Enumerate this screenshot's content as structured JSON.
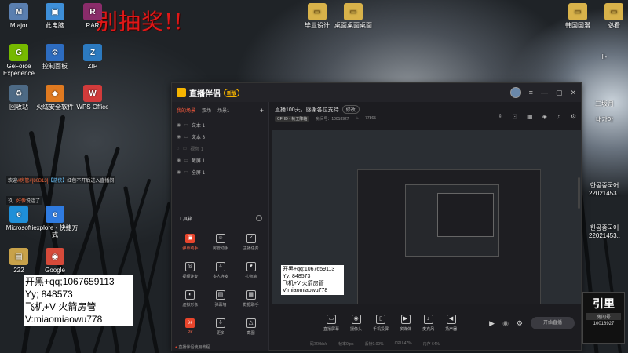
{
  "desktop": {
    "icons": [
      {
        "id": "major",
        "label": "M ajor",
        "glyph": "M",
        "color": "#5a7fb0"
      },
      {
        "id": "computer",
        "label": "此电脑",
        "glyph": "▣",
        "color": "#3e8fd8"
      },
      {
        "id": "rar",
        "label": "RAR",
        "glyph": "R",
        "color": "#8a2c6a"
      },
      {
        "id": "geforce",
        "label": "GeForce Experience",
        "glyph": "G",
        "color": "#76b900"
      },
      {
        "id": "control",
        "label": "控制面板",
        "glyph": "⚙",
        "color": "#2d6cc0"
      },
      {
        "id": "zip",
        "label": "ZIP",
        "glyph": "Z",
        "color": "#2c7ac0"
      },
      {
        "id": "recycle",
        "label": "回收站",
        "glyph": "♻",
        "color": "#4d6a85"
      },
      {
        "id": "security",
        "label": "火绒安全软件",
        "glyph": "◆",
        "color": "#e07a20"
      },
      {
        "id": "wps",
        "label": "WPS Office",
        "glyph": "W",
        "color": "#d13b3b"
      },
      {
        "id": "edge",
        "label": "Microsoft",
        "glyph": "e",
        "color": "#1f8fd8"
      },
      {
        "id": "iexplore",
        "label": "iexplore - 快捷方式",
        "glyph": "e",
        "color": "#2f7be0"
      },
      {
        "id": "num222",
        "label": "222",
        "glyph": "▤",
        "color": "#c8a24a"
      },
      {
        "id": "google",
        "label": "Google",
        "glyph": "◉",
        "color": "#d64a3a"
      },
      {
        "id": "folder1",
        "label": "毕业设计",
        "glyph": "▭",
        "color": "#d8b24a"
      },
      {
        "id": "folder2",
        "label": "桌面桌面桌面",
        "glyph": "▭",
        "color": "#d8b24a"
      },
      {
        "id": "folder3",
        "label": "韩国国漫",
        "glyph": "▭",
        "color": "#d8b24a"
      },
      {
        "id": "folder4",
        "label": "必看",
        "glyph": "▭",
        "color": "#d8b24a"
      }
    ],
    "right_labels": [
      "ll-",
      "三坂月",
      "내가아",
      "한공중국어",
      "22021453..",
      "한공중국어",
      "22021453.."
    ],
    "banner": "别抽奖!!"
  },
  "chat": {
    "line1_prefix": "欢迎",
    "line1_user": "#房管#[80B13]",
    "line1_tag": "【游侠】",
    "line1_text": "红包不开后进入直播间",
    "line2_prefix": "玖...",
    "line2_user": "好像",
    "line2_text": "说话了"
  },
  "contact": {
    "line1": "开黑+qq;1067659113",
    "line2": "Yy; 848573",
    "line3": "飞机+V 火箭房管",
    "line4": "V:miaomiaowu778"
  },
  "app": {
    "title": "直播伴侣",
    "version": "新版",
    "scene_tabs": [
      "我的场景",
      "双场",
      "场景1"
    ],
    "sources": [
      {
        "label": "文本 1",
        "dim": false
      },
      {
        "label": "文本 3",
        "dim": false
      },
      {
        "label": "视频 1",
        "dim": true
      },
      {
        "label": "截屏 1",
        "dim": false
      },
      {
        "label": "全屏 1",
        "dim": false
      }
    ],
    "tools_label": "工具箱",
    "tools": [
      {
        "label": "弹幕助手",
        "icon": "▣",
        "active": true
      },
      {
        "label": "房管助手",
        "icon": "☺",
        "active": false
      },
      {
        "label": "主播任务",
        "icon": "✓",
        "active": false
      },
      {
        "label": "视频连麦",
        "icon": "◎",
        "active": false
      },
      {
        "label": "多人连麦",
        "icon": "⇩",
        "active": false
      },
      {
        "label": "礼物墙",
        "icon": "♥",
        "active": false
      },
      {
        "label": "虚拟形象",
        "icon": "◐",
        "active": false
      },
      {
        "label": "弹幕墙",
        "icon": "▤",
        "active": false
      },
      {
        "label": "数据助手",
        "icon": "▦",
        "active": false
      },
      {
        "label": "PK",
        "icon": "⚔",
        "active": false
      },
      {
        "label": "更多",
        "icon": "⇩",
        "active": false
      },
      {
        "label": "截图",
        "icon": "△",
        "active": false
      }
    ],
    "notice": "直播伴侣使用教程",
    "room_title": "直播100天，感谢各位支持",
    "room_edit": "修改",
    "room_tag": "CFHD - 枪王降临",
    "room_id_label": "房间号：10018927",
    "room_heat": "77865",
    "bottom_tools": [
      {
        "label": "直播屏幕",
        "icon": "▭"
      },
      {
        "label": "摄像头",
        "icon": "◉"
      },
      {
        "label": "手机投屏",
        "icon": "▯"
      },
      {
        "label": "多媒体",
        "icon": "▶"
      },
      {
        "label": "麦克风",
        "icon": "♪"
      },
      {
        "label": "扬声器",
        "icon": "◀"
      }
    ],
    "start_label": "开始直播",
    "status": [
      "码率0kb/s",
      "帧率0fps",
      "丢帧0.00%",
      "CPU 47%",
      "内存 64%"
    ]
  },
  "live_widget": {
    "brand": "引里",
    "label": "房间号",
    "room": "10018927"
  }
}
